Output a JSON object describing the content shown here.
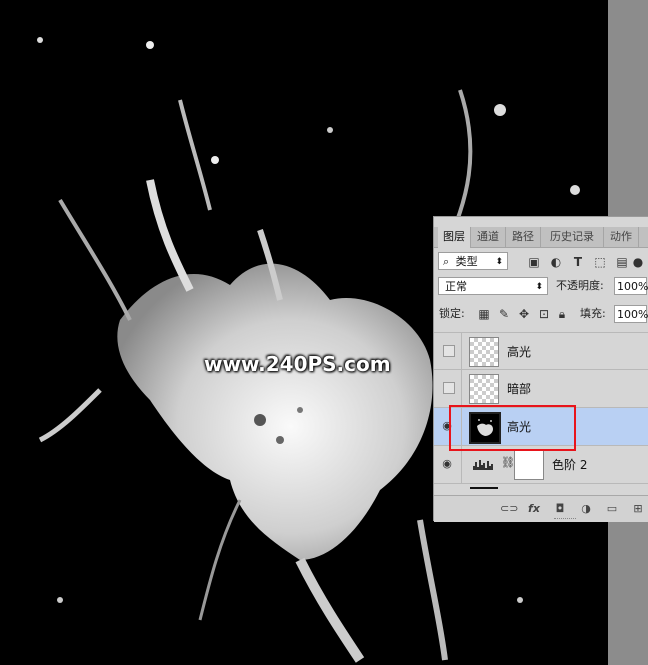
{
  "watermark": {
    "text": "www.240PS.com"
  },
  "panel": {
    "tabs": [
      {
        "label": "图层",
        "active": true
      },
      {
        "label": "通道",
        "active": false
      },
      {
        "label": "路径",
        "active": false
      },
      {
        "label": "历史记录",
        "active": false
      },
      {
        "label": "动作",
        "active": false
      }
    ],
    "filter": {
      "kind_label": "类型",
      "icons": [
        "image-filter-icon",
        "adjustment-filter-icon",
        "type-filter-icon",
        "shape-filter-icon",
        "smart-object-filter-icon"
      ]
    },
    "blend": {
      "mode": "正常",
      "opacity_label": "不透明度:",
      "opacity": "100%"
    },
    "lock": {
      "label": "锁定:",
      "fill_label": "填充:",
      "fill": "100%"
    },
    "layers": [
      {
        "name": "高光",
        "visible": false,
        "thumb": "transparent",
        "selected": false
      },
      {
        "name": "暗部",
        "visible": false,
        "thumb": "transparent",
        "selected": false
      },
      {
        "name": "高光",
        "visible": true,
        "thumb": "black",
        "selected": true
      },
      {
        "name": "色阶 2",
        "visible": true,
        "thumb": "adjustment",
        "selected": false
      }
    ],
    "bottom": {
      "fx_label": "fx"
    }
  },
  "colors": {
    "selection": "#b9d0f3",
    "highlight_box": "#e8141b"
  }
}
